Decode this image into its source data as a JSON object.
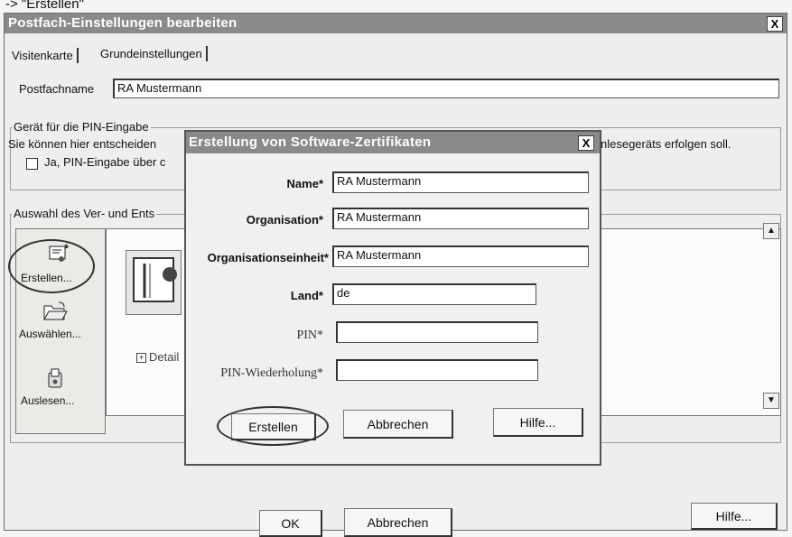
{
  "caption": "-> \"Erstellen\"",
  "window": {
    "title": "Postfach-Einstellungen bearbeiten",
    "close": "X"
  },
  "tabs": [
    "Visitenkarte",
    "Grundeinstellungen"
  ],
  "mailbox_name": {
    "label": "Postfachname",
    "value": "RA Mustermann"
  },
  "pin_group": {
    "legend": "Gerät für die PIN-Eingabe",
    "text_left": "Sie können hier entscheiden",
    "text_right": "nlesegeräts erfolgen soll.",
    "checkbox_label": "Ja, PIN-Eingabe über c"
  },
  "selection_group": {
    "legend": "Auswahl des Ver- und Ents"
  },
  "sidebar": {
    "create": "Erstellen...",
    "select": "Auswählen...",
    "read": "Auslesen..."
  },
  "list": {
    "details": "Detail"
  },
  "main_buttons": {
    "ok": "OK",
    "cancel": "Abbrechen",
    "help": "Hilfe..."
  },
  "dialog": {
    "title": "Erstellung von Software-Zertifikaten",
    "close": "X",
    "fields": {
      "name": {
        "label": "Name*",
        "value": "RA Mustermann"
      },
      "organisation": {
        "label": "Organisation*",
        "value": "RA Mustermann"
      },
      "unit": {
        "label": "Organisationseinheit*",
        "value": "RA Mustermann"
      },
      "country": {
        "label": "Land*",
        "value": "de"
      },
      "pin": {
        "label": "PIN*",
        "value": ""
      },
      "pin_repeat": {
        "label": "PIN-Wiederholung*",
        "value": ""
      }
    },
    "buttons": {
      "create": "Erstellen",
      "cancel": "Abbrechen",
      "help": "Hilfe..."
    }
  }
}
